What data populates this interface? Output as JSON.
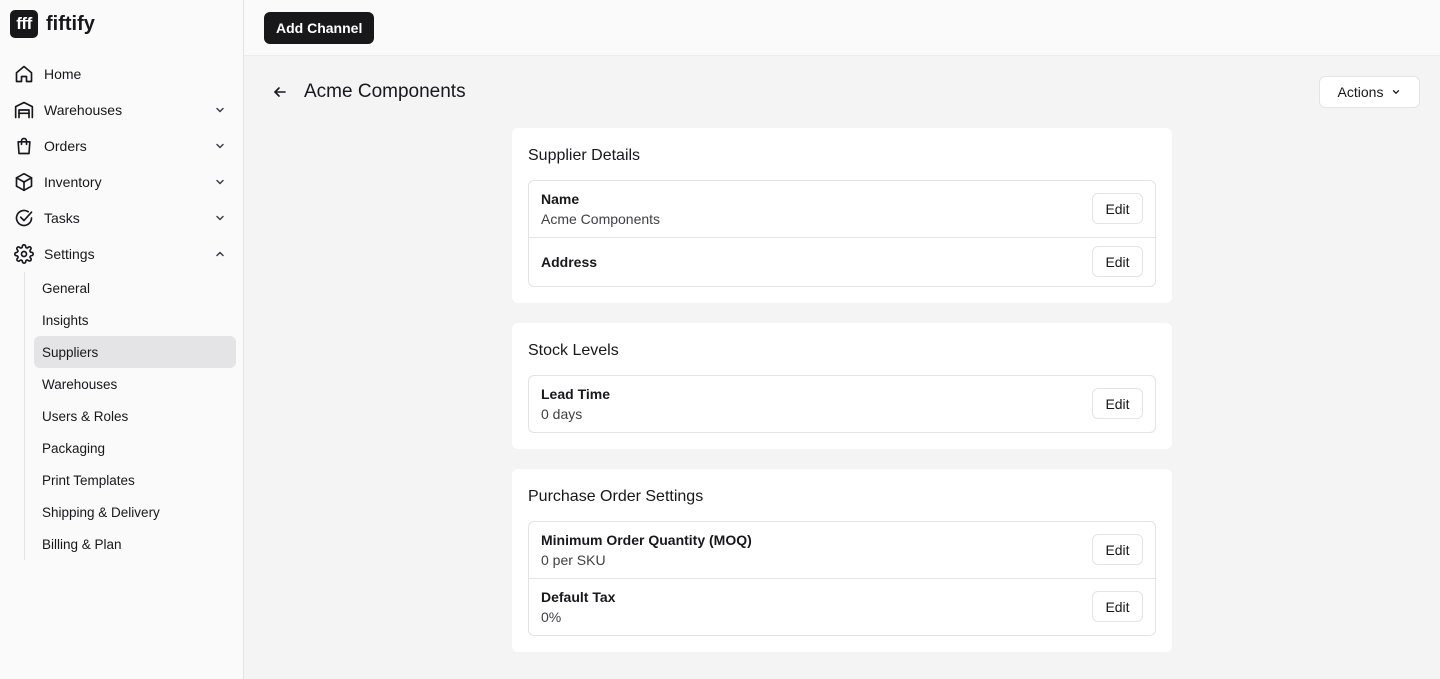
{
  "app": {
    "logo_mark": "fff",
    "name": "fiftify"
  },
  "nav": [
    {
      "label": "Home",
      "icon": "home-icon",
      "expandable": false
    },
    {
      "label": "Warehouses",
      "icon": "warehouse-icon",
      "expandable": true,
      "expanded": false
    },
    {
      "label": "Orders",
      "icon": "shopping-bag-icon",
      "expandable": true,
      "expanded": false
    },
    {
      "label": "Inventory",
      "icon": "box-icon",
      "expandable": true,
      "expanded": false
    },
    {
      "label": "Tasks",
      "icon": "check-circle-icon",
      "expandable": true,
      "expanded": false
    },
    {
      "label": "Settings",
      "icon": "gear-icon",
      "expandable": true,
      "expanded": true
    }
  ],
  "settings_sub": [
    {
      "label": "General",
      "active": false
    },
    {
      "label": "Insights",
      "active": false
    },
    {
      "label": "Suppliers",
      "active": true
    },
    {
      "label": "Warehouses",
      "active": false
    },
    {
      "label": "Users & Roles",
      "active": false
    },
    {
      "label": "Packaging",
      "active": false
    },
    {
      "label": "Print Templates",
      "active": false
    },
    {
      "label": "Shipping & Delivery",
      "active": false
    },
    {
      "label": "Billing & Plan",
      "active": false
    }
  ],
  "topbar": {
    "add_channel_label": "Add Channel"
  },
  "page": {
    "title": "Acme Components",
    "actions_label": "Actions"
  },
  "sections": [
    {
      "title": "Supplier Details",
      "rows": [
        {
          "label": "Name",
          "value": "Acme Components",
          "edit_label": "Edit"
        },
        {
          "label": "Address",
          "value": "",
          "edit_label": "Edit"
        }
      ]
    },
    {
      "title": "Stock Levels",
      "rows": [
        {
          "label": "Lead Time",
          "value": "0 days",
          "edit_label": "Edit"
        }
      ]
    },
    {
      "title": "Purchase Order Settings",
      "rows": [
        {
          "label": "Minimum Order Quantity (MOQ)",
          "value": "0 per SKU",
          "edit_label": "Edit"
        },
        {
          "label": "Default Tax",
          "value": "0%",
          "edit_label": "Edit"
        }
      ]
    }
  ]
}
